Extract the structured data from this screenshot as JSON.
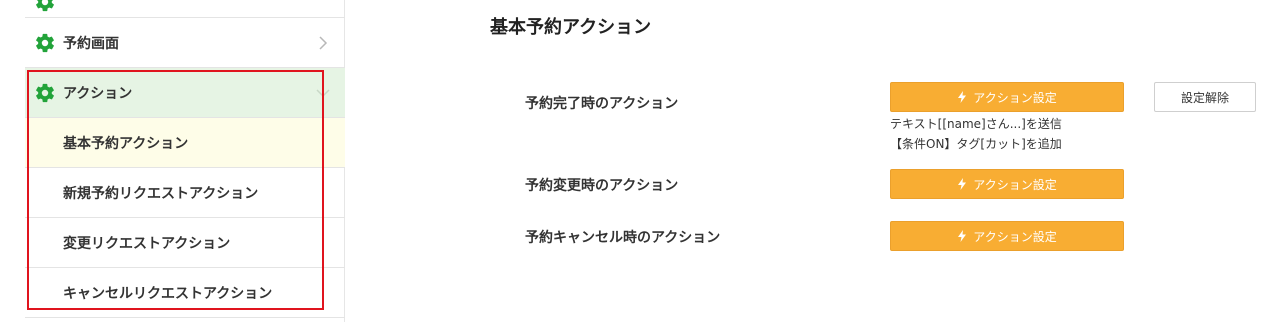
{
  "sidebar": {
    "items": [
      {
        "label": ""
      },
      {
        "label": "予約画面"
      },
      {
        "label": "アクション"
      }
    ],
    "sub_items": [
      {
        "label": "基本予約アクション"
      },
      {
        "label": "新規予約リクエストアクション"
      },
      {
        "label": "変更リクエストアクション"
      },
      {
        "label": "キャンセルリクエストアクション"
      }
    ]
  },
  "main": {
    "title": "基本予約アクション",
    "actions": [
      {
        "label": "予約完了時のアクション",
        "button_label": "アクション設定",
        "clear_label": "設定解除",
        "summary": [
          "テキスト[[name]さん...]を送信",
          "【条件ON】タグ[カット]を追加"
        ]
      },
      {
        "label": "予約変更時のアクション",
        "button_label": "アクション設定"
      },
      {
        "label": "予約キャンセル時のアクション",
        "button_label": "アクション設定"
      }
    ]
  },
  "colors": {
    "accent_orange": "#f8ad33",
    "gear_green": "#22a33a",
    "active_section_bg": "#e6f4e4",
    "active_item_bg": "#fefde8",
    "highlight_red": "#e0141e"
  },
  "icons": {
    "gear": "gear-icon",
    "chevron": "chevron-right-icon",
    "chevron_down": "chevron-down-icon",
    "bolt": "bolt-icon"
  }
}
